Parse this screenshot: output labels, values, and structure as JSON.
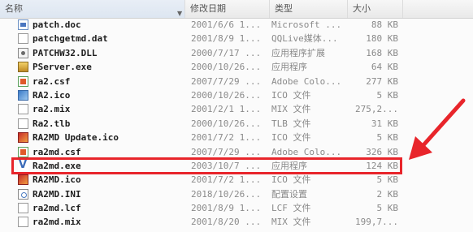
{
  "header": {
    "name": "名称",
    "date": "修改日期",
    "type": "类型",
    "size": "大小"
  },
  "files": [
    {
      "name": "patch.doc",
      "date": "2001/6/6 1...",
      "type": "Microsoft ...",
      "size": "88 KB",
      "icon": "doc-icon"
    },
    {
      "name": "patchgetmd.dat",
      "date": "2001/8/9 1...",
      "type": "QQLive媒体...",
      "size": "180 KB",
      "icon": "file-icon"
    },
    {
      "name": "PATCHW32.DLL",
      "date": "2000/7/17 ...",
      "type": "应用程序扩展",
      "size": "168 KB",
      "icon": "dll-icon"
    },
    {
      "name": "PServer.exe",
      "date": "2000/10/26...",
      "type": "应用程序",
      "size": "64 KB",
      "icon": "exe-icon"
    },
    {
      "name": "ra2.csf",
      "date": "2007/7/29 ...",
      "type": "Adobe Colo...",
      "size": "277 KB",
      "icon": "csf-icon"
    },
    {
      "name": "RA2.ico",
      "date": "2000/10/26...",
      "type": "ICO 文件",
      "size": "5 KB",
      "icon": "ico-icon"
    },
    {
      "name": "ra2.mix",
      "date": "2001/2/1 1...",
      "type": "MIX 文件",
      "size": "275,2...",
      "icon": "file-icon"
    },
    {
      "name": "Ra2.tlb",
      "date": "2000/10/26...",
      "type": "TLB 文件",
      "size": "31 KB",
      "icon": "file-icon"
    },
    {
      "name": "RA2MD Update.ico",
      "date": "2001/7/2 1...",
      "type": "ICO 文件",
      "size": "5 KB",
      "icon": "ra2hd-icon"
    },
    {
      "name": "ra2md.csf",
      "date": "2007/7/29 ...",
      "type": "Adobe Colo...",
      "size": "326 KB",
      "icon": "csf-icon"
    },
    {
      "name": "Ra2md.exe",
      "date": "2003/10/7 ...",
      "type": "应用程序",
      "size": "124 KB",
      "icon": "v-icon",
      "highlighted": true
    },
    {
      "name": "RA2MD.ico",
      "date": "2001/7/2 1...",
      "type": "ICO 文件",
      "size": "5 KB",
      "icon": "ra2hd-icon"
    },
    {
      "name": "RA2MD.INI",
      "date": "2018/10/26...",
      "type": "配置设置",
      "size": "2 KB",
      "icon": "ini-icon"
    },
    {
      "name": "ra2md.lcf",
      "date": "2001/8/9 1...",
      "type": "LCF 文件",
      "size": "5 KB",
      "icon": "file-icon"
    },
    {
      "name": "ra2md.mix",
      "date": "2001/8/20 ...",
      "type": "MIX 文件",
      "size": "199,7...",
      "icon": "file-icon"
    }
  ],
  "annotation": {
    "color": "#e8252b"
  }
}
